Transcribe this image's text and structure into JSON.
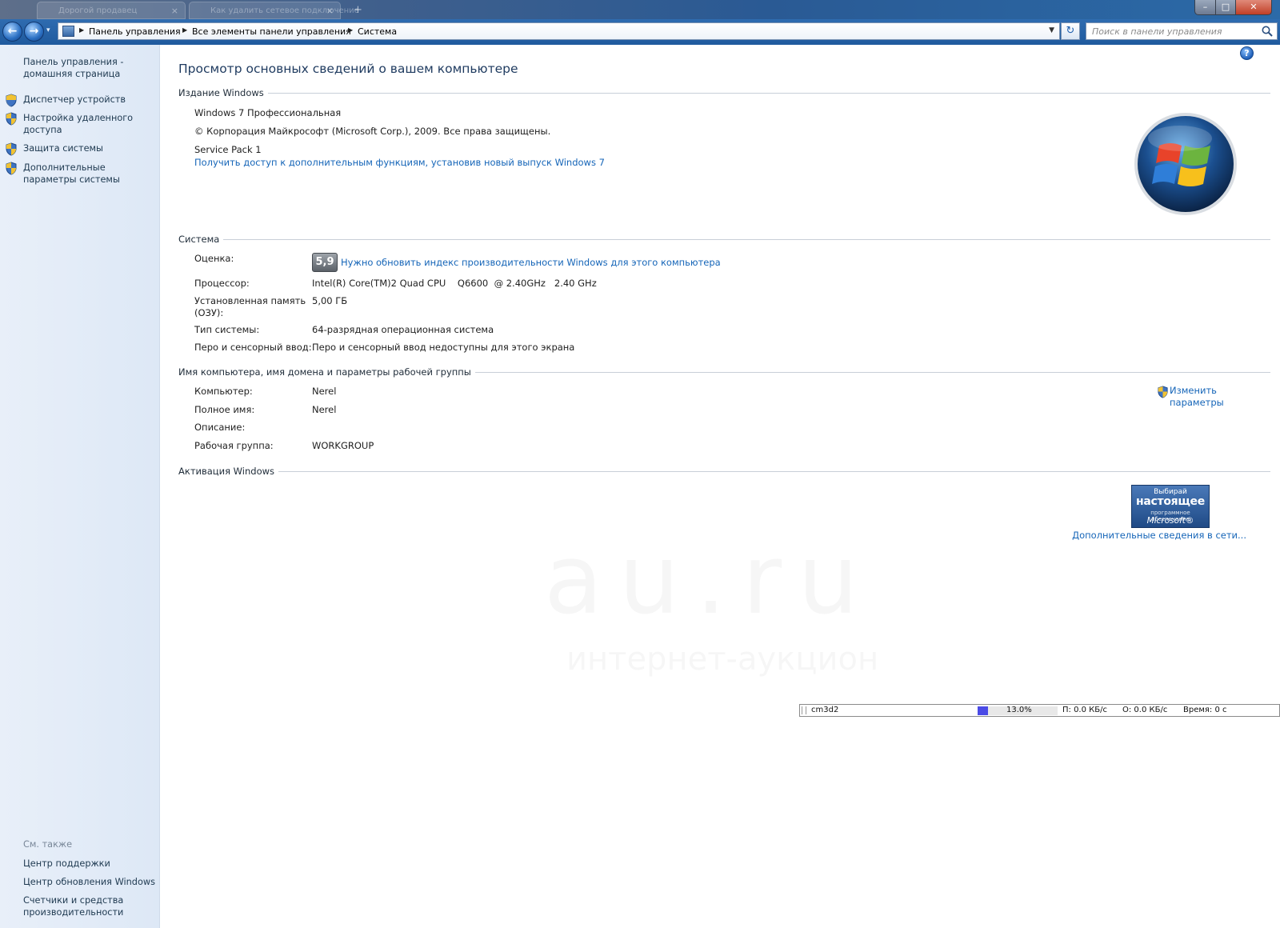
{
  "browser_tabs": [
    {
      "label": "Дорогой продавец"
    },
    {
      "label": "Как удалить сетевое подключение"
    }
  ],
  "window_controls": {
    "minimize": "–",
    "maximize": "□",
    "close": "✕"
  },
  "nav": {
    "back_icon": "←",
    "forward_icon": "→",
    "history_icon": "▾",
    "breadcrumbs": [
      "Панель управления",
      "Все элементы панели управления",
      "Система"
    ],
    "refresh_icon": "↻",
    "search_placeholder": "Поиск в панели управления"
  },
  "sidebar": {
    "home": "Панель управления - домашняя страница",
    "items": [
      {
        "label": "Диспетчер устройств",
        "icon": "shield-icon"
      },
      {
        "label": "Настройка удаленного доступа",
        "icon": "shield-icon"
      },
      {
        "label": "Защита системы",
        "icon": "shield-icon"
      },
      {
        "label": "Дополнительные параметры системы",
        "icon": "shield-icon"
      }
    ],
    "see_also_title": "См. также",
    "see_also": [
      "Центр поддержки",
      "Центр обновления Windows",
      "Счетчики и средства производительности"
    ]
  },
  "main": {
    "help_icon": "?",
    "title": "Просмотр основных сведений о вашем компьютере",
    "edition": {
      "heading": "Издание Windows",
      "name": "Windows 7 Профессиональная",
      "copyright": "© Корпорация Майкрософт (Microsoft Corp.), 2009. Все права защищены.",
      "service_pack": "Service Pack 1",
      "upgrade_link": "Получить доступ к дополнительным функциям, установив новый выпуск Windows 7"
    },
    "system": {
      "heading": "Система",
      "rating_label": "Оценка:",
      "rating_score": "5,9",
      "rating_link": "Нужно обновить индекс производительности Windows для этого компьютера",
      "processor_label": "Процессор:",
      "processor_value": "Intel(R) Core(TM)2 Quad CPU    Q6600  @ 2.40GHz   2.40 GHz",
      "ram_label": "Установленная память (ОЗУ):",
      "ram_value": "5,00 ГБ",
      "type_label": "Тип системы:",
      "type_value": "64-разрядная операционная система",
      "pen_label": "Перо и сенсорный ввод:",
      "pen_value": "Перо и сенсорный ввод недоступны для этого экрана"
    },
    "computer": {
      "heading": "Имя компьютера, имя домена и параметры рабочей группы",
      "computer_label": "Компьютер:",
      "computer_value": "Nerel",
      "fullname_label": "Полное имя:",
      "fullname_value": "Nerel",
      "description_label": "Описание:",
      "description_value": "",
      "workgroup_label": "Рабочая группа:",
      "workgroup_value": "WORKGROUP",
      "change_link": "Изменить параметры"
    },
    "activation": {
      "heading": "Активация Windows",
      "badge_line1": "Выбирай",
      "badge_line2": "настоящее",
      "badge_line3": "программное обеспечение",
      "badge_line4": "Microsoft®",
      "more_link": "Дополнительные сведения в сети..."
    },
    "watermark": {
      "big": "au.ru",
      "small": "интернет-аукцион"
    }
  },
  "monitor": {
    "process": "cm3d2",
    "load_fraction": 0.13,
    "percent": "13.0%",
    "download": "П: 0.0 КБ/с",
    "upload": "О: 0.0 КБ/с",
    "time": "Время: 0 с"
  },
  "colors": {
    "link": "#1565b8",
    "title": "#1e3a5f",
    "navbar": "#2f6cb0",
    "sidebar_bg": "#e3ecf8",
    "monitor_bar": "#4b4be6"
  }
}
